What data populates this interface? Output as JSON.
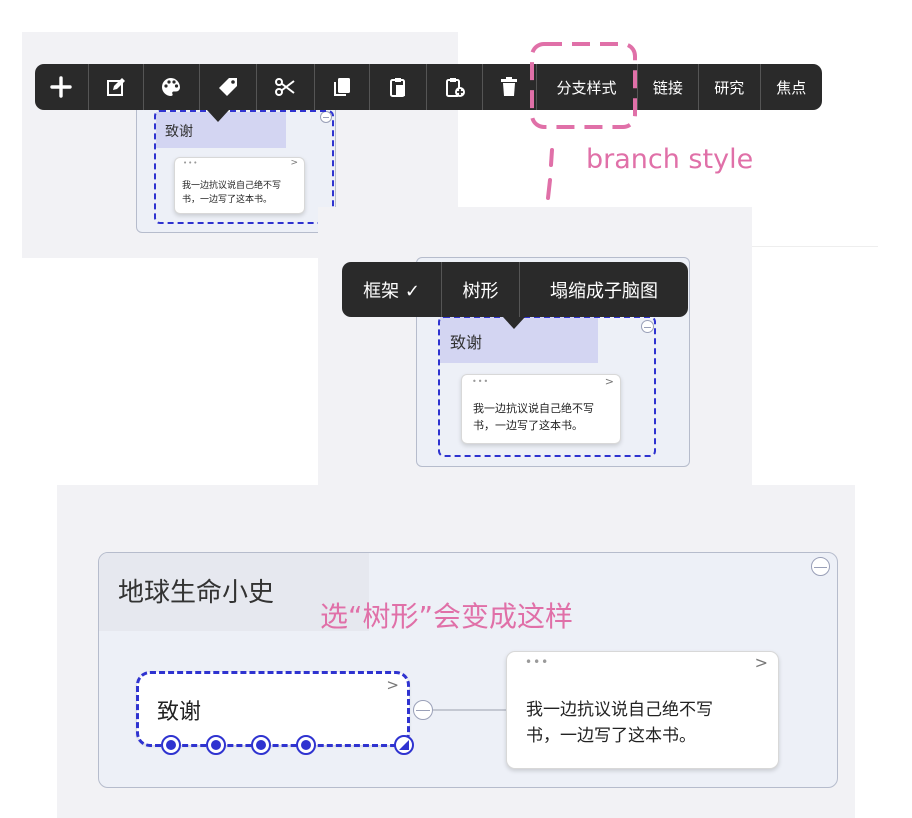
{
  "toolbar": {
    "add_icon": "plus-icon",
    "edit_icon": "edit-icon",
    "style_icon": "palette-icon",
    "tag_icon": "tag-icon",
    "cut_icon": "scissors-icon",
    "copy_icon": "copy-icon",
    "paste_icon": "paste-icon",
    "paste_add_icon": "clipboard-add-icon",
    "delete_icon": "trash-icon",
    "branch_style": "分支样式",
    "link": "链接",
    "research": "研究",
    "focus": "焦点"
  },
  "branch_menu": {
    "frame": "框架 ✓",
    "tree": "树形",
    "collapse_submap": "塌缩成子脑图"
  },
  "mindmap": {
    "root_title": "地球生命小史",
    "child_topic": "致谢",
    "note_line1": "我一边抗议说自己绝不写",
    "note_line2": "书，一边写了这本书。",
    "note_dots": "•••",
    "note_chevron": ">"
  },
  "annotations": {
    "branch_style_label": "branch style",
    "tree_result_label": "选“树形”会变成这样"
  },
  "colors": {
    "accent_pink": "#e070a8",
    "selection_blue": "#2f33d0",
    "toolbar_bg": "#2a2a2a"
  }
}
